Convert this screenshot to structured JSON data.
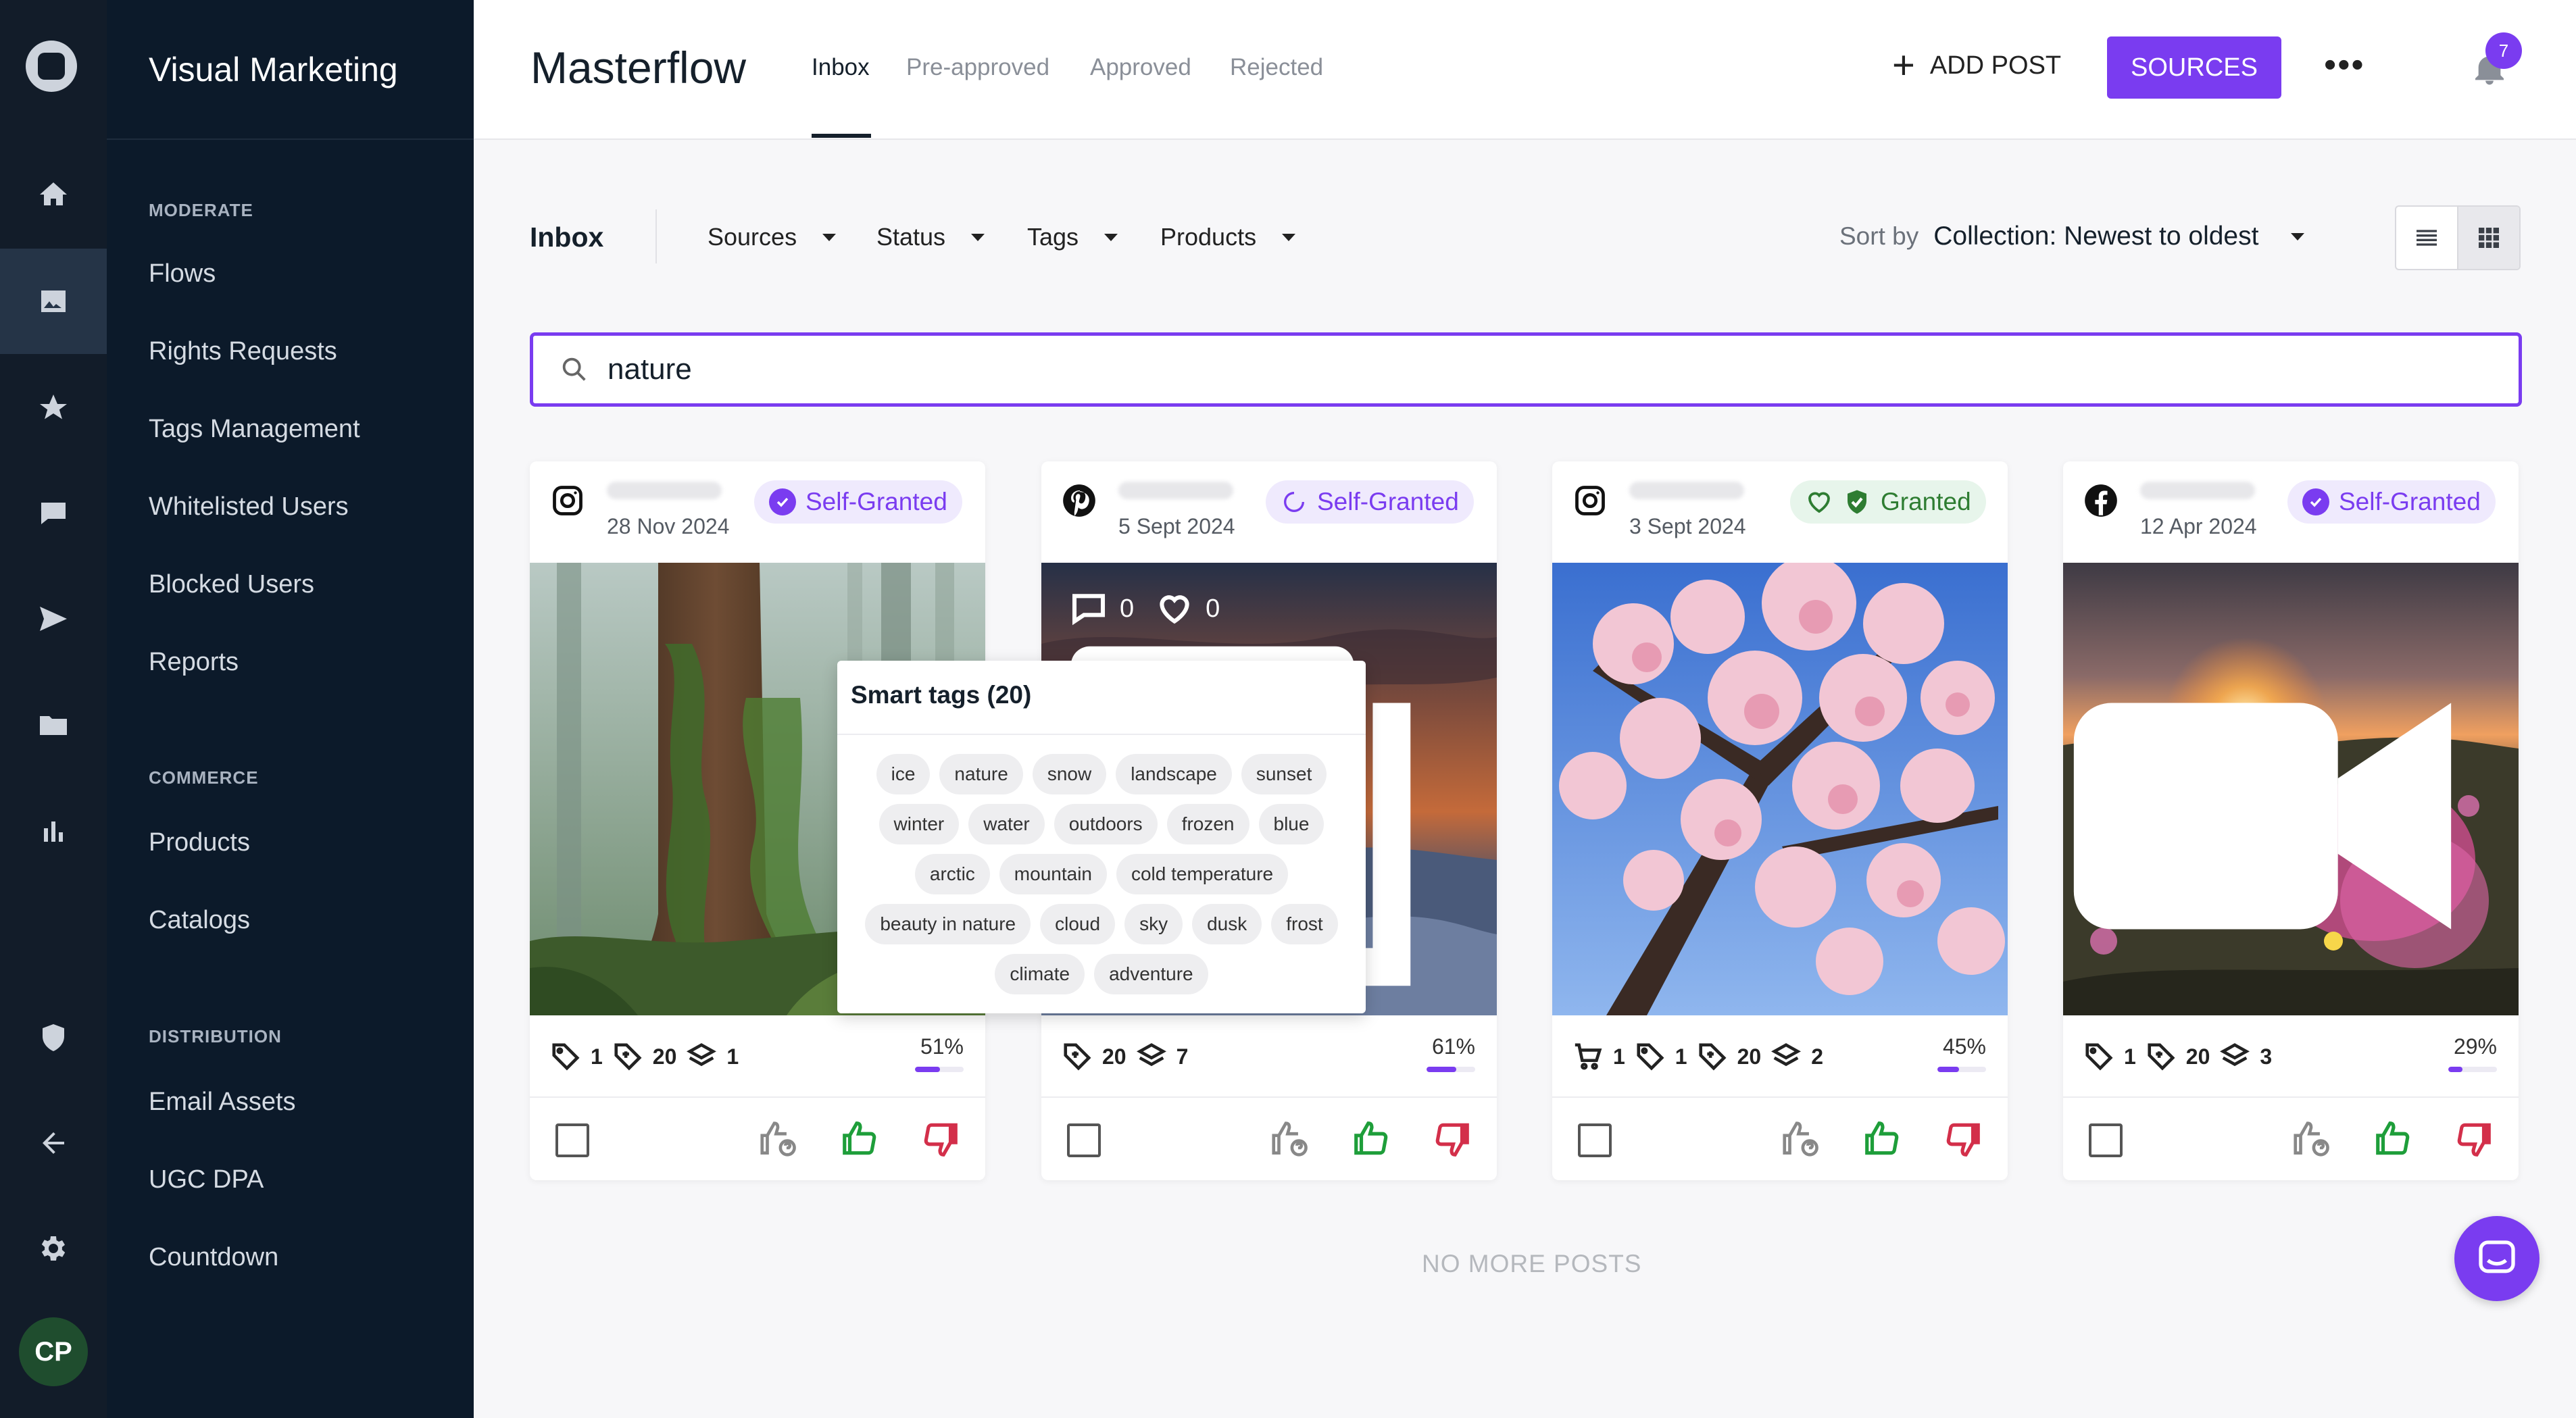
{
  "rail": {
    "avatar_initials": "CP",
    "items": [
      "home-icon",
      "image-icon",
      "star-icon",
      "chat-icon",
      "send-icon",
      "folder-icon",
      "bar-chart-icon",
      "shield-icon",
      "arrow-left-icon",
      "gear-icon"
    ],
    "active": "image-icon"
  },
  "sidebar": {
    "workspace": "Visual Marketing",
    "sections": [
      {
        "label": "MODERATE",
        "items": [
          "Flows",
          "Rights Requests",
          "Tags Management",
          "Whitelisted Users",
          "Blocked Users",
          "Reports"
        ]
      },
      {
        "label": "COMMERCE",
        "items": [
          "Products",
          "Catalogs"
        ]
      },
      {
        "label": "DISTRIBUTION",
        "items": [
          "Email Assets",
          "UGC DPA",
          "Countdown"
        ]
      }
    ]
  },
  "header": {
    "title": "Masterflow",
    "tabs": [
      "Inbox",
      "Pre-approved",
      "Approved",
      "Rejected"
    ],
    "active_tab": "Inbox",
    "add_post": "ADD POST",
    "sources": "SOURCES",
    "notification_count": "7"
  },
  "filters": {
    "label": "Inbox",
    "items": [
      "Sources",
      "Status",
      "Tags",
      "Products"
    ],
    "sort_label": "Sort by",
    "sort_value": "Collection: Newest to oldest"
  },
  "search": {
    "value": "nature"
  },
  "cards": [
    {
      "platform": "instagram",
      "date": "28 Nov 2024",
      "status": "Self-Granted",
      "stats": [
        "1",
        "20",
        "1"
      ],
      "percent": "51%",
      "percent_value": 0.51
    },
    {
      "platform": "pinterest",
      "date": "5 Sept 2024",
      "status": "Self-Granted",
      "stats": [
        "20",
        "7"
      ],
      "overlay": {
        "comments": "0",
        "likes": "0"
      },
      "percent": "61%",
      "percent_value": 0.61
    },
    {
      "platform": "instagram",
      "date": "3 Sept 2024",
      "status": "Granted",
      "stats": [
        "1",
        "1",
        "20",
        "2"
      ],
      "percent": "45%",
      "percent_value": 0.45
    },
    {
      "platform": "facebook",
      "date": "12 Apr 2024",
      "status": "Self-Granted",
      "stats": [
        "1",
        "20",
        "3"
      ],
      "percent": "29%",
      "percent_value": 0.29
    }
  ],
  "smart_tags": {
    "title": "Smart tags (20)",
    "tags": [
      "ice",
      "nature",
      "snow",
      "landscape",
      "sunset",
      "winter",
      "water",
      "outdoors",
      "frozen",
      "blue",
      "arctic",
      "mountain",
      "cold temperature",
      "beauty in nature",
      "cloud",
      "sky",
      "dusk",
      "frost",
      "climate",
      "adventure"
    ]
  },
  "footer": {
    "no_more": "NO MORE POSTS"
  },
  "colors": {
    "accent": "#7a3cf0",
    "sidebar": "#0c1a2a",
    "approve": "#1e9e3a",
    "reject": "#d32f4a"
  }
}
